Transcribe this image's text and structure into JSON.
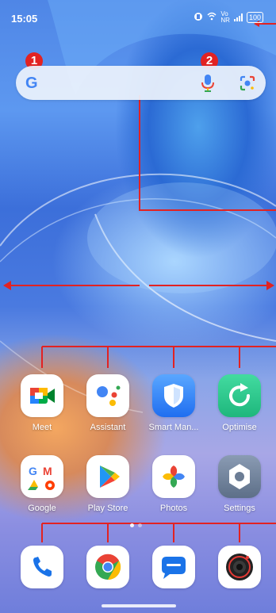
{
  "status_bar": {
    "time": "15:05",
    "vo_label": "Vo",
    "nr_label": "NR",
    "battery": "100"
  },
  "annotations": {
    "badge_1": "1",
    "badge_2": "2"
  },
  "search_bar": {
    "google_logo": "G"
  },
  "apps_row1": [
    {
      "label": "Meet",
      "icon": "meet-icon"
    },
    {
      "label": "Assistant",
      "icon": "assistant-icon"
    },
    {
      "label": "Smart Man...",
      "icon": "shield-icon"
    },
    {
      "label": "Optimise",
      "icon": "optimise-icon"
    }
  ],
  "apps_row2": [
    {
      "label": "Google",
      "icon": "google-folder-icon"
    },
    {
      "label": "Play Store",
      "icon": "play-store-icon"
    },
    {
      "label": "Photos",
      "icon": "photos-icon"
    },
    {
      "label": "Settings",
      "icon": "settings-icon"
    }
  ],
  "dock": [
    {
      "icon": "phone-icon"
    },
    {
      "icon": "chrome-icon"
    },
    {
      "icon": "messages-icon"
    },
    {
      "icon": "camera-icon"
    }
  ],
  "colors": {
    "annotation_red": "#e22222",
    "google_blue": "#4285F4"
  }
}
